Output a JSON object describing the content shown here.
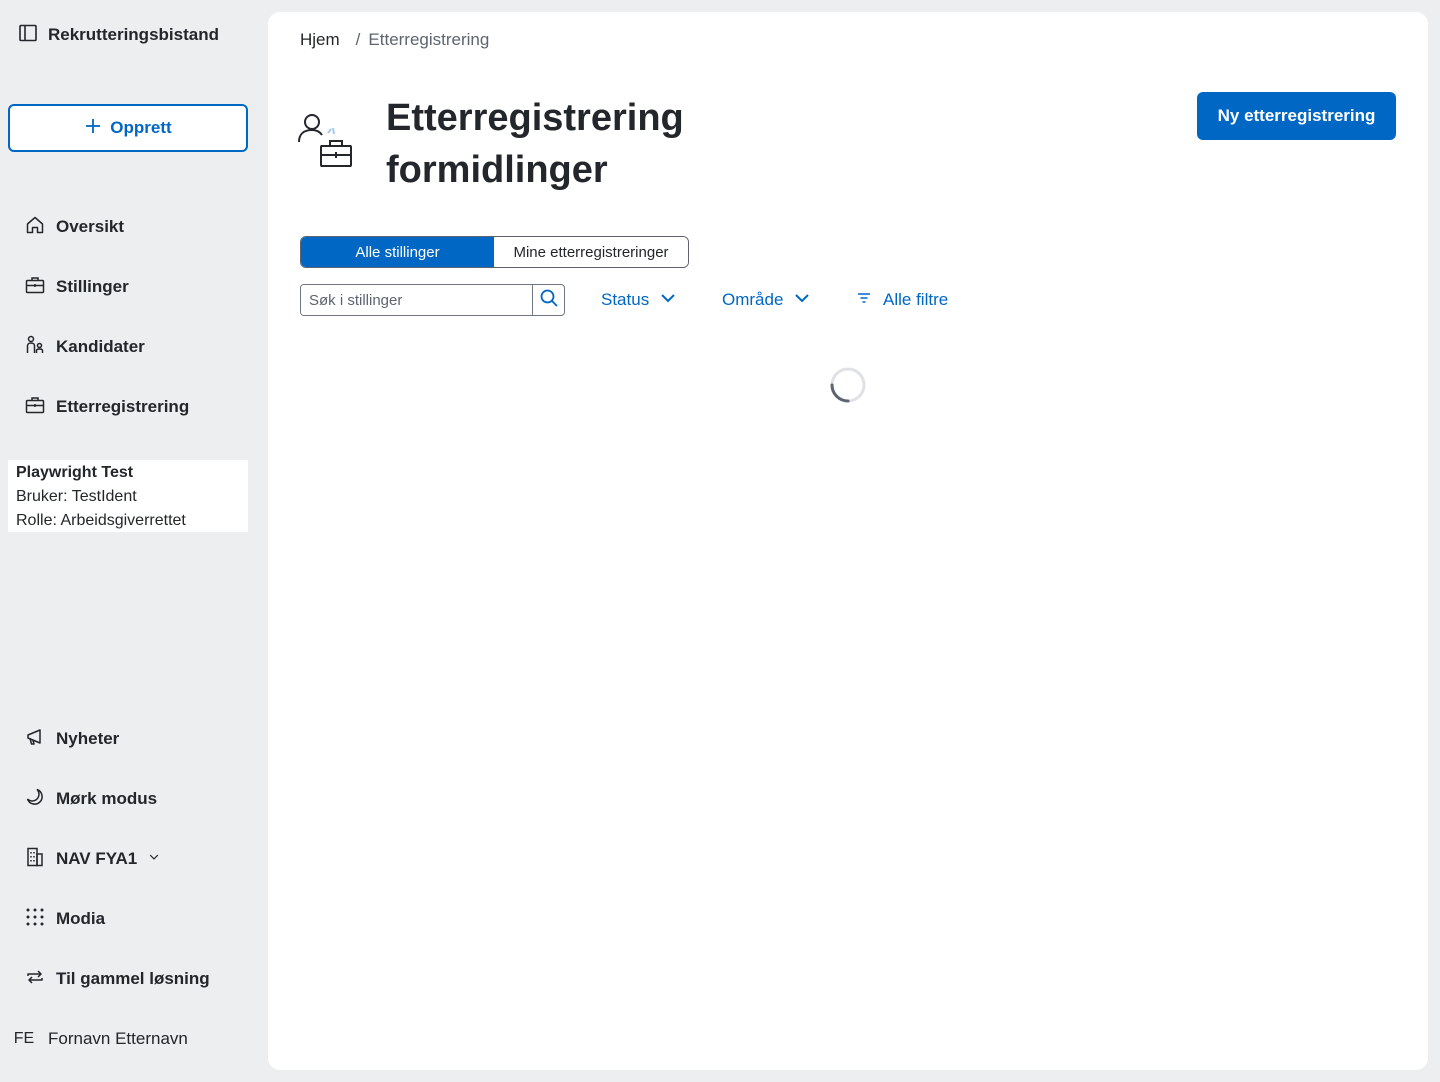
{
  "app": {
    "title": "Rekrutteringsbistand"
  },
  "sidebar": {
    "create_label": "Opprett",
    "nav": [
      {
        "label": "Oversikt",
        "icon": "house-icon"
      },
      {
        "label": "Stillinger",
        "icon": "briefcase-icon"
      },
      {
        "label": "Kandidater",
        "icon": "people-icon"
      },
      {
        "label": "Etterregistrering",
        "icon": "briefcase-icon"
      }
    ],
    "user": {
      "name": "Playwright Test",
      "ident": "Bruker: TestIdent",
      "role": "Rolle: Arbeidsgiverrettet"
    },
    "bottom": [
      {
        "label": "Nyheter",
        "icon": "megaphone-icon"
      },
      {
        "label": "Mørk modus",
        "icon": "moon-icon"
      },
      {
        "label": "NAV FYA1",
        "icon": "buildings-icon"
      },
      {
        "label": "Modia",
        "icon": "grid-dots-icon"
      },
      {
        "label": "Til gammel løsning",
        "icon": "arrows-circle-icon"
      }
    ],
    "profile": {
      "initials": "FE",
      "name": "Fornavn Etternavn"
    }
  },
  "breadcrumb": {
    "home": "Hjem",
    "separator": "/",
    "current": "Etterregistrering"
  },
  "page": {
    "title_line1": "Etterregistrering",
    "title_line2": "formidlinger",
    "new_button": "Ny etterregistrering"
  },
  "toggle": {
    "all": "Alle stillinger",
    "mine": "Mine etterregistreringer",
    "selected": "Alle stillinger"
  },
  "search": {
    "placeholder": "Søk i stillinger",
    "value": ""
  },
  "filters": {
    "status": "Status",
    "area": "Område",
    "all_filters": "Alle filtre"
  },
  "colors": {
    "accent": "#0067c5",
    "background": "#eceef0",
    "text": "#23262a"
  }
}
